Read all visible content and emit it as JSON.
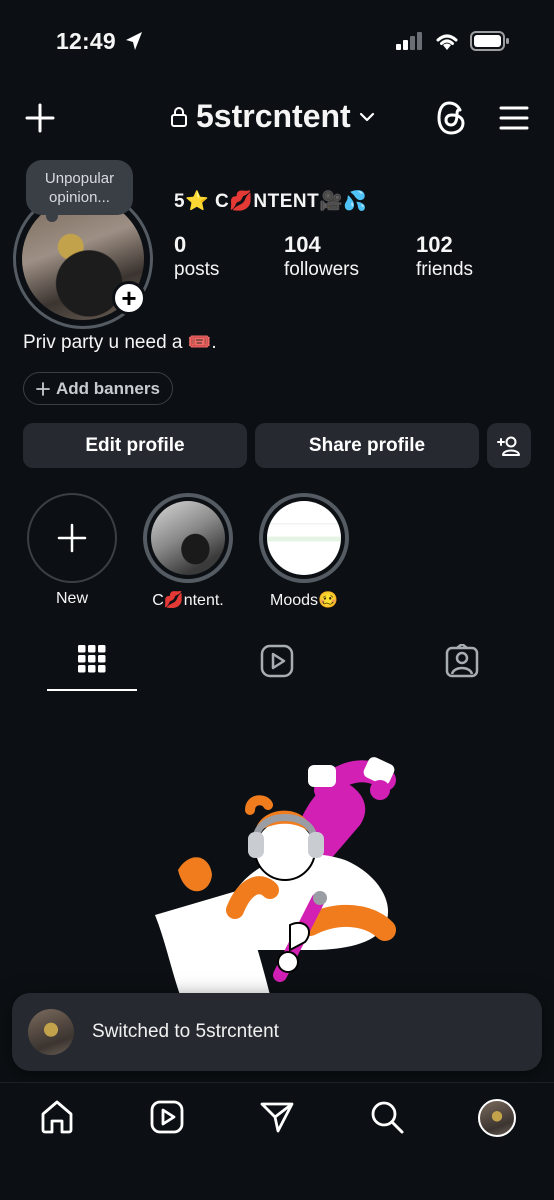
{
  "status_bar": {
    "time": "12:49"
  },
  "header": {
    "username": "5strcntent"
  },
  "profile": {
    "note": "Unpopular opinion...",
    "display_name": "5⭐ C💋NTENT🎥💦",
    "stats": {
      "posts": {
        "value": "0",
        "label": "posts"
      },
      "followers": {
        "value": "104",
        "label": "followers"
      },
      "friends": {
        "value": "102",
        "label": "friends"
      }
    },
    "bio": "Priv party u need a 🎟️.",
    "add_banners": "Add banners"
  },
  "actions": {
    "edit_profile": "Edit profile",
    "share_profile": "Share profile"
  },
  "highlights": [
    {
      "label": "New"
    },
    {
      "label": "C💋ntent."
    },
    {
      "label": "Moods🥴"
    }
  ],
  "tabs": [
    "grid-icon",
    "reels-icon",
    "tagged-icon"
  ],
  "toast": {
    "text": "Switched to 5strcntent"
  },
  "nav": [
    "home-icon",
    "reels-icon",
    "send-icon",
    "search-icon",
    "profile-avatar"
  ],
  "colors": {
    "background": "#0c1014",
    "button": "#262a30",
    "ring": "#555b63",
    "accent_orange": "#f07c1e",
    "accent_magenta": "#d21fb4"
  }
}
